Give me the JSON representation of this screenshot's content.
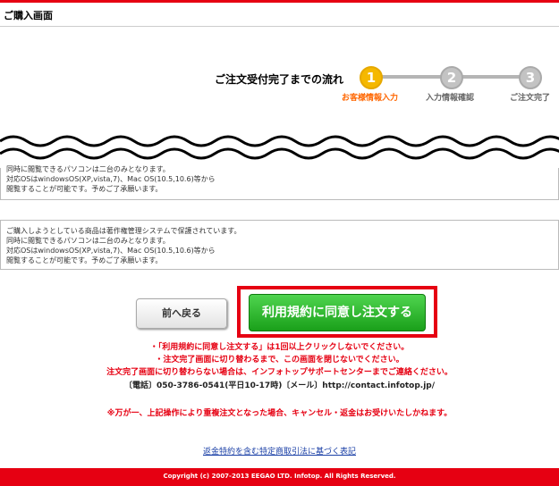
{
  "header": {
    "title": "ご購入画面"
  },
  "flow": {
    "title": "ご注文受付完了までの流れ",
    "steps": [
      {
        "num": "1",
        "label": "お客様情報入力",
        "state": "active"
      },
      {
        "num": "2",
        "label": "入力情報確認",
        "state": "inactive"
      },
      {
        "num": "3",
        "label": "ご注文完了",
        "state": "inactive"
      }
    ]
  },
  "notice_top": [
    "同時に閲覧できるパソコンは二台のみとなります。",
    "対応OSはwindowsOS(XP,vista,7)、Mac OS(10.5,10.6)等から",
    "閲覧することが可能です。予めご了承願います。"
  ],
  "notice_box": [
    "ご購入しようとしている商品は著作権管理システムで保護されています。",
    "同時に閲覧できるパソコンは二台のみとなります。",
    "対応OSはwindowsOS(XP,vista,7)、Mac OS(10.5,10.6)等から",
    "閲覧することが可能です。予めご了承願います。"
  ],
  "buttons": {
    "back": "前へ戻る",
    "agree": "利用規約に同意し注文する"
  },
  "warnings": {
    "line1": "・「利用規約に同意し注文する」は1回以上クリックしないでください。",
    "line2": "・注文完了画面に切り替わるまで、この画面を閉じないでください。",
    "line3": "注文完了画面に切り替わらない場合は、インフォトップサポートセンターまでご連絡ください。",
    "line4": "〔電話〕050-3786-0541(平日10-17時)〔メール〕http://contact.infotop.jp/",
    "line5": "※万が一、上記操作により重複注文となった場合、キャンセル・返金はお受けいたしかねます。"
  },
  "refund_link": "返金特約を含む特定商取引法に基づく表記",
  "footer": "Copyright (c) 2007-2013 EEGAO LTD. Infotop. All Rights Reserved.",
  "colors": {
    "brand_red": "#e60012",
    "step_active": "#f5b800",
    "agree_green": "#1aa01a"
  }
}
